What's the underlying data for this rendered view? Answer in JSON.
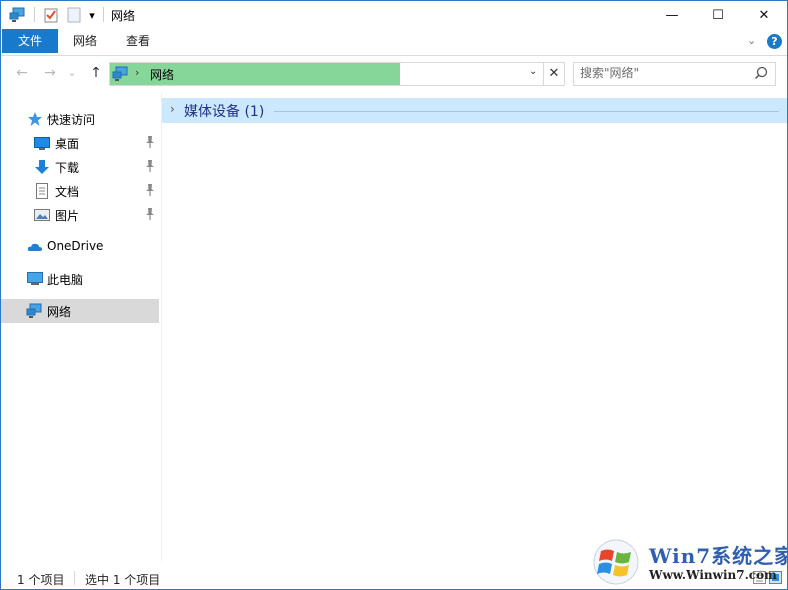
{
  "titlebar": {
    "title": "网络",
    "qa_dropdown_glyph": "▾",
    "minimize_glyph": "—",
    "maximize_glyph": "☐",
    "close_glyph": "✕"
  },
  "ribbon": {
    "tabs": [
      {
        "label": "文件",
        "active": true
      },
      {
        "label": "网络",
        "active": false
      },
      {
        "label": "查看",
        "active": false
      }
    ],
    "expand_glyph": "⌄",
    "help_glyph": "?"
  },
  "navigation": {
    "back_glyph": "←",
    "forward_glyph": "→",
    "recent_glyph": "⌄",
    "up_glyph": "↑"
  },
  "address": {
    "separator_glyph": "›",
    "path": "网络",
    "dropdown_glyph": "⌄",
    "clear_glyph": "✕"
  },
  "search": {
    "placeholder": "搜索\"网络\""
  },
  "nav_pane": {
    "quick_access": {
      "label": "快速访问",
      "icon": "star-icon"
    },
    "quick_items": [
      {
        "label": "桌面",
        "icon": "desktop-icon",
        "pinned": true
      },
      {
        "label": "下载",
        "icon": "download-icon",
        "pinned": true
      },
      {
        "label": "文档",
        "icon": "document-icon",
        "pinned": true
      },
      {
        "label": "图片",
        "icon": "pictures-icon",
        "pinned": true
      }
    ],
    "onedrive": {
      "label": "OneDrive",
      "icon": "cloud-icon"
    },
    "this_pc": {
      "label": "此电脑",
      "icon": "computer-icon"
    },
    "network": {
      "label": "网络",
      "icon": "network-icon",
      "selected": true
    }
  },
  "content": {
    "group": {
      "chevron_glyph": "›",
      "label": "媒体设备 (1)"
    }
  },
  "statusbar": {
    "item_count": "1 个项目",
    "selected_count": "选中 1 个项目"
  },
  "watermark": {
    "title": "Win7系统之家",
    "url": "Www.Winwin7.com"
  },
  "colors": {
    "accent": "#1979ca",
    "address_highlight": "#86d69a",
    "group_header_bg": "#cce8ff",
    "nav_selected": "#d9d9d9",
    "window_border": "#2b79c2"
  }
}
